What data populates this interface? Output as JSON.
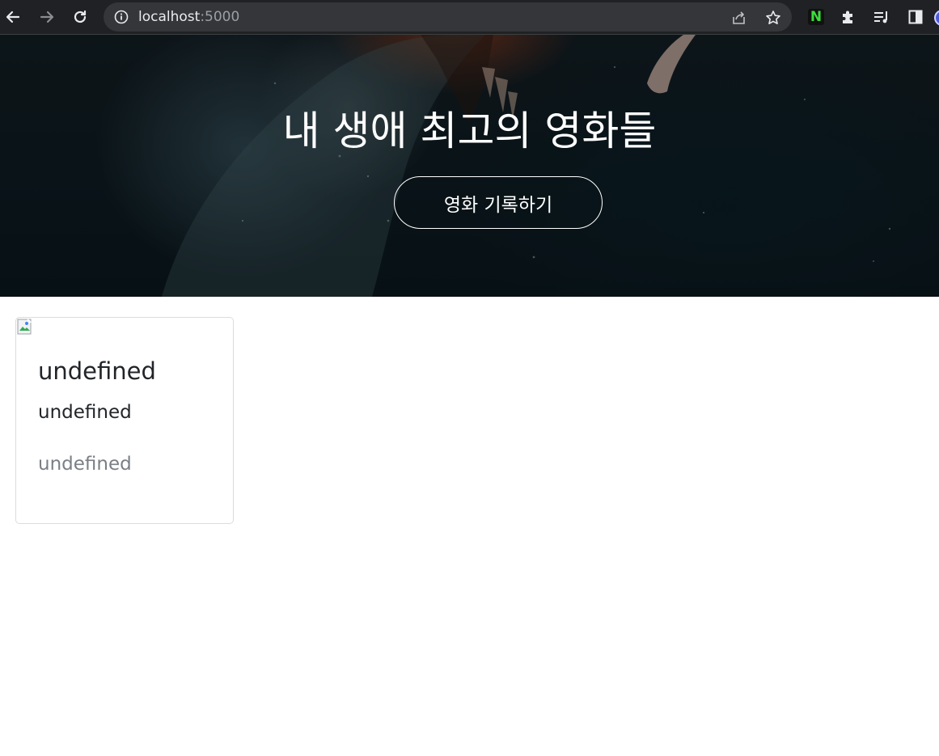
{
  "browser": {
    "url_host": "localhost",
    "url_port": ":5000",
    "icons": [
      "back-arrow-icon",
      "forward-arrow-icon",
      "reload-icon",
      "site-info-icon",
      "share-icon",
      "bookmark-star-icon",
      "extension-n-icon",
      "puzzle-extensions-icon",
      "reading-list-icon",
      "side-panel-icon",
      "profile-avatar-icon"
    ],
    "extension_letter": "N"
  },
  "hero": {
    "title": "내 생애 최고의 영화들",
    "button_label": "영화 기록하기"
  },
  "cards": [
    {
      "title": "undefined",
      "text": "undefined",
      "muted": "undefined"
    }
  ]
}
